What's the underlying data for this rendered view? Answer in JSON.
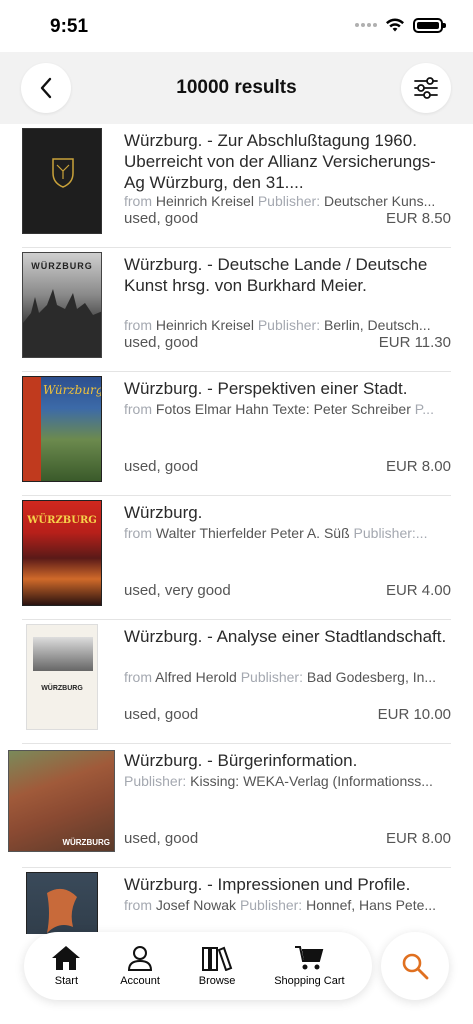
{
  "status_bar": {
    "time": "9:51"
  },
  "header": {
    "title": "10000 results"
  },
  "results": [
    {
      "title": "Würzburg.  - Zur Abschlußtagung 1960. Uberreicht von der Allianz Versicherungs-Ag Würzburg, den 31....",
      "from_label": "from",
      "author": "Heinrich Kreisel",
      "publisher_label": "Publisher:",
      "publisher": "Deutscher Kuns...",
      "condition": "used, good",
      "price": "EUR 8.50"
    },
    {
      "title": "Würzburg.  - Deutsche Lande / Deutsche Kunst hrsg. von Burkhard Meier.",
      "from_label": "from",
      "author": "Heinrich Kreisel",
      "publisher_label": "Publisher:",
      "publisher": "Berlin, Deutsch...",
      "condition": "used, good",
      "price": "EUR 11.30",
      "cover_text": "WÜRZBURG"
    },
    {
      "title": "Würzburg.  - Perspektiven einer Stadt.",
      "from_label": "from",
      "author": "Fotos Elmar Hahn Texte: Peter Schreiber",
      "publisher_label": "P...",
      "publisher": "",
      "condition": "used, good",
      "price": "EUR 8.00",
      "cover_text": "Würzburg"
    },
    {
      "title": "Würzburg.",
      "from_label": "from",
      "author": "Walter Thierfelder Peter A. Süß",
      "publisher_label": "Publisher:",
      "publisher": "...",
      "condition": "used, very good",
      "price": "EUR 4.00",
      "cover_text": "WÜRZBURG"
    },
    {
      "title": "Würzburg.  - Analyse einer Stadtlandschaft.",
      "from_label": "from",
      "author": "Alfred Herold",
      "publisher_label": "Publisher:",
      "publisher": "Bad Godesberg, In...",
      "condition": "used, good",
      "price": "EUR 10.00",
      "cover_text": "WÜRZBURG"
    },
    {
      "title": "Würzburg.  - Bürgerinformation.",
      "from_label": "",
      "author": "",
      "publisher_label": "Publisher:",
      "publisher": "Kissing: WEKA-Verlag (Informationss...",
      "condition": "used, good",
      "price": "EUR 8.00",
      "cover_text": "WÜRZBURG"
    },
    {
      "title": "Würzburg.  - Impressionen und Profile.",
      "from_label": "from",
      "author": "Josef Nowak",
      "publisher_label": "Publisher:",
      "publisher": "Honnef, Hans Pete...",
      "condition": "",
      "price": ""
    }
  ],
  "bottom_nav": {
    "items": [
      {
        "label": "Start",
        "icon": "home-icon"
      },
      {
        "label": "Account",
        "icon": "user-icon"
      },
      {
        "label": "Browse",
        "icon": "books-icon"
      },
      {
        "label": "Shopping Cart",
        "icon": "cart-icon"
      }
    ],
    "search_icon": "search-icon"
  },
  "colors": {
    "accent": "#e07020",
    "header_bg": "#f2f2f2",
    "label_gray": "#a4a8b0"
  }
}
